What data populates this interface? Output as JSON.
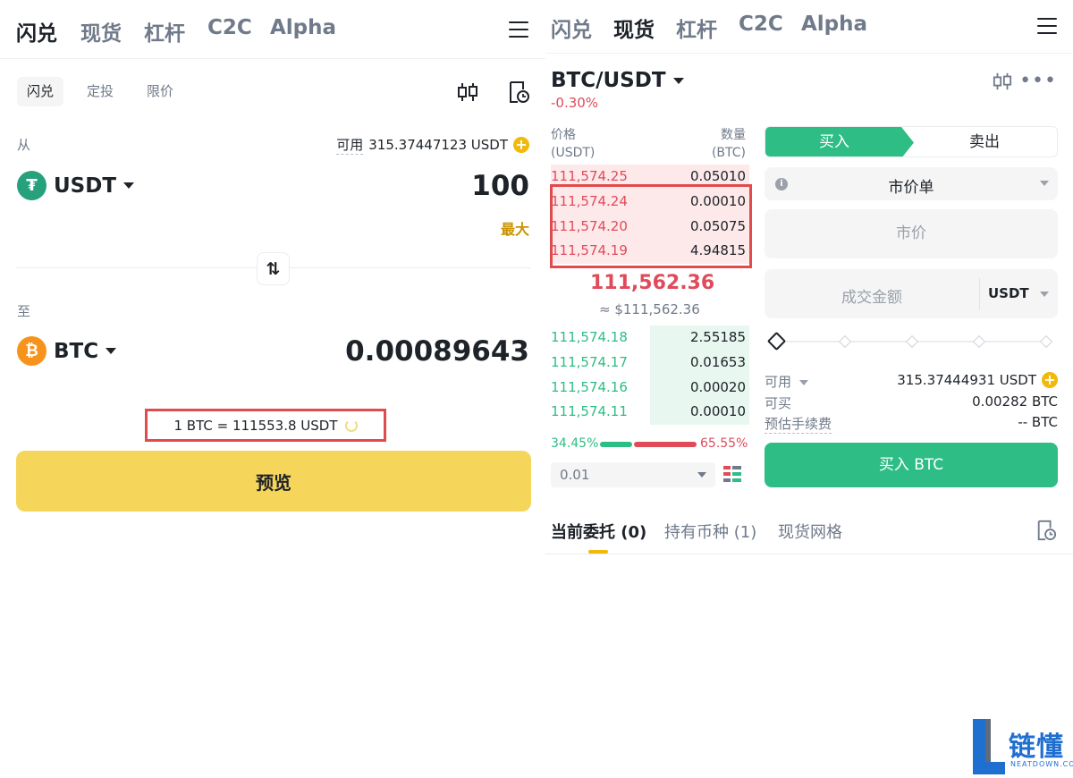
{
  "left": {
    "nav_tabs": [
      "闪兑",
      "现货",
      "杠杆",
      "C2C",
      "Alpha"
    ],
    "active_nav": 0,
    "sub_tabs": [
      "闪兑",
      "定投",
      "限价"
    ],
    "active_sub": 0,
    "from_label": "从",
    "available_label": "可用",
    "available_value": "315.37447123 USDT",
    "from_coin": "USDT",
    "from_amount": "100",
    "max_label": "最大",
    "swap_icon": "⇅",
    "to_label": "至",
    "to_coin": "BTC",
    "to_amount": "0.00089643",
    "rate_text": "1 BTC = 111553.8 USDT",
    "preview_label": "预览"
  },
  "right": {
    "nav_tabs": [
      "闪兑",
      "现货",
      "杠杆",
      "C2C",
      "Alpha"
    ],
    "active_nav": 1,
    "pair": "BTC/USDT",
    "change": "-0.30%",
    "orderbook": {
      "price_header": "价格",
      "price_unit": "(USDT)",
      "qty_header": "数量",
      "qty_unit": "(BTC)",
      "asks": [
        {
          "price": "111,574.25",
          "qty": "0.05010",
          "depth": 1.0
        },
        {
          "price": "111,574.24",
          "qty": "0.00010",
          "depth": 1.0
        },
        {
          "price": "111,574.20",
          "qty": "0.05075",
          "depth": 1.0
        },
        {
          "price": "111,574.19",
          "qty": "4.94815",
          "depth": 1.0
        }
      ],
      "last_price": "111,562.36",
      "last_price_usd": "≈ $111,562.36",
      "bids": [
        {
          "price": "111,574.18",
          "qty": "2.55185",
          "depth": 0.5
        },
        {
          "price": "111,574.17",
          "qty": "0.01653",
          "depth": 0.5
        },
        {
          "price": "111,574.16",
          "qty": "0.00020",
          "depth": 0.5
        },
        {
          "price": "111,574.11",
          "qty": "0.00010",
          "depth": 0.5
        }
      ],
      "buy_ratio": "34.45%",
      "sell_ratio": "65.55%",
      "buy_ratio_value": 34.45,
      "sell_ratio_value": 65.55,
      "depth_precision": "0.01"
    },
    "form": {
      "buy_tab": "买入",
      "sell_tab": "卖出",
      "order_type": "市价单",
      "market_price_placeholder": "市价",
      "amount_placeholder": "成交金额",
      "amount_currency": "USDT",
      "slider_value": 0,
      "available_label": "可用",
      "available_value": "315.37444931 USDT",
      "can_buy_label": "可买",
      "can_buy_value": "0.00282 BTC",
      "fee_label": "预估手续费",
      "fee_value": "-- BTC",
      "buy_button": "买入 BTC"
    },
    "bottom_tabs": [
      "当前委托 (0)",
      "持有币种 (1)",
      "现货网格"
    ],
    "active_bottom_tab": 0
  },
  "watermark": {
    "text": "链懂",
    "sub": "NEATDOWN.COM"
  },
  "colors": {
    "accent_yellow": "#f0b90b",
    "preview_button": "#f5d55a",
    "buy_green": "#2ebd85",
    "sell_red": "#e04b5a",
    "highlight_box": "#e04b4b",
    "watermark_blue": "#1f6fd1"
  },
  "icons": {
    "menu": "hamburger-icon",
    "kline": "candlestick-icon",
    "history": "order-history-icon",
    "swap": "swap-arrows-icon",
    "usdt": "tether-icon",
    "btc": "bitcoin-icon",
    "more": "more-dots-icon"
  }
}
